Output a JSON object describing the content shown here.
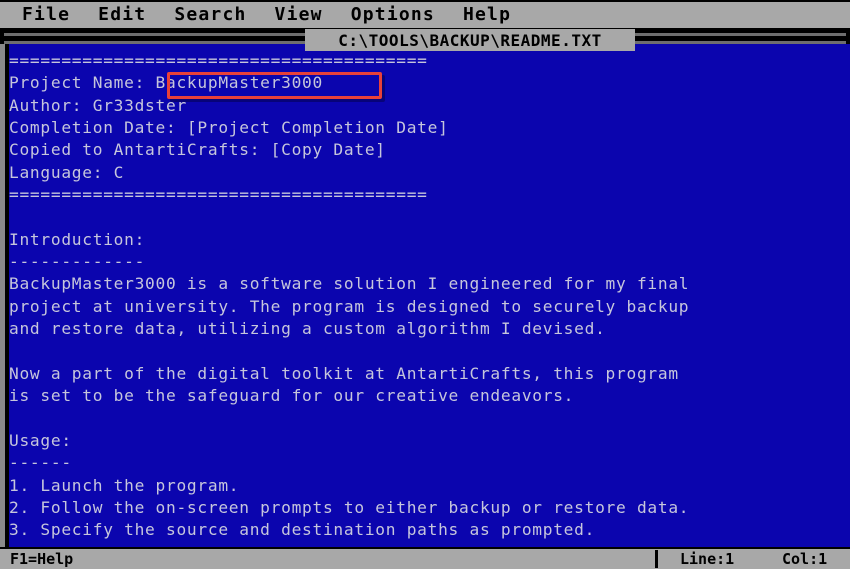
{
  "window": {
    "title": "C:\\TOOLS\\BACKUP\\README.TXT",
    "background_color": "#0b05ae",
    "text_color": "#c6c6dc",
    "chrome_color": "#a8a8a8",
    "highlight_color": "#e8413a"
  },
  "menubar": {
    "items": [
      {
        "label": "File"
      },
      {
        "label": "Edit"
      },
      {
        "label": "Search"
      },
      {
        "label": "View"
      },
      {
        "label": "Options"
      },
      {
        "label": "Help"
      }
    ]
  },
  "document": {
    "highlighted_value": "BackupMaster3000",
    "body": "========================================\nProject Name: BackupMaster3000\nAuthor: Gr33dster\nCompletion Date: [Project Completion Date]\nCopied to AntartiCrafts: [Copy Date]\nLanguage: C\n========================================\n\nIntroduction:\n-------------\nBackupMaster3000 is a software solution I engineered for my final\nproject at university. The program is designed to securely backup\nand restore data, utilizing a custom algorithm I devised.\n\nNow a part of the digital toolkit at AntartiCrafts, this program\nis set to be the safeguard for our creative endeavors.\n\nUsage:\n------\n1. Launch the program.\n2. Follow the on-screen prompts to either backup or restore data.\n3. Specify the source and destination paths as prompted."
  },
  "statusbar": {
    "help_hint": "F1=Help",
    "line_indicator": "Line:1",
    "col_indicator": "Col:1"
  }
}
